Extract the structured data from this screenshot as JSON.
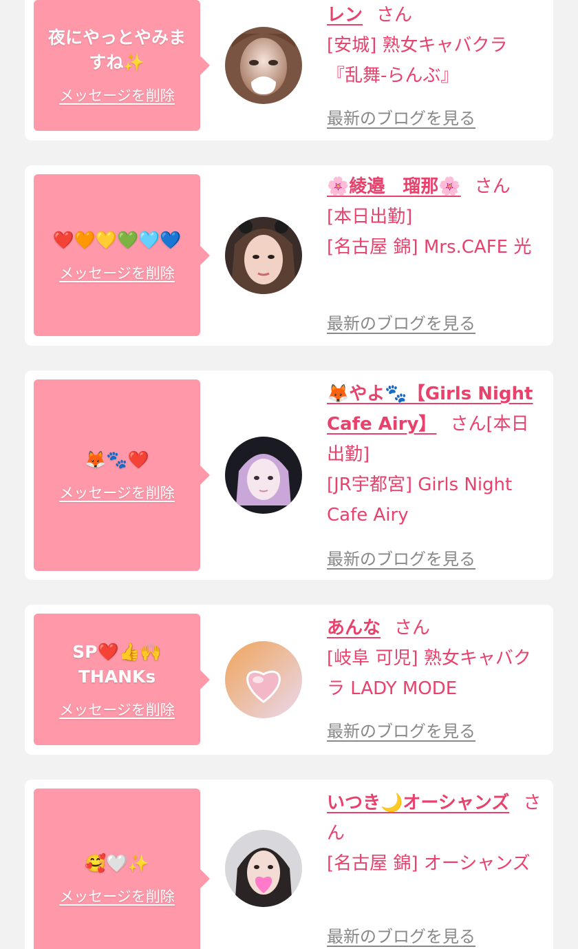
{
  "colors": {
    "background": "#f2f2f2",
    "card": "#ffffff",
    "bubble": "#ff99aa",
    "accent": "#e8416c",
    "blog_link": "#888888"
  },
  "cards": [
    {
      "message": "夜にやっとやみますね✨",
      "delete_label": "メッセージを削除",
      "name": "レン",
      "honorific": "さん",
      "details": [
        "[安城] 熟女キャバクラ『乱舞-らんぶ』"
      ],
      "blog_label": "最新のブログを見る"
    },
    {
      "message": "❤️🧡💛💚🩵💙",
      "delete_label": "メッセージを削除",
      "name": "🌸綾邉　瑠那🌸",
      "honorific": "さん",
      "details": [
        "[本日出勤]",
        "[名古屋 錦] Mrs.CAFE 光"
      ],
      "blog_label": "最新のブログを見る"
    },
    {
      "message": "🦊🐾❤️",
      "delete_label": "メッセージを削除",
      "name": "🦊やよ🐾【Girls Night Cafe Airy】",
      "honorific": "さん",
      "details": [
        "[本日出勤]",
        "[JR宇都宮] Girls Night Cafe Airy"
      ],
      "blog_label": "最新のブログを見る"
    },
    {
      "message": "SP❤️👍🙌THANKs",
      "delete_label": "メッセージを削除",
      "name": "あんな",
      "honorific": "さん",
      "details": [
        "[岐阜 可児] 熟女キャバクラ LADY MODE"
      ],
      "blog_label": "最新のブログを見る"
    },
    {
      "message": "🥰🤍✨",
      "delete_label": "メッセージを削除",
      "name": "いつき🌙オーシャンズ",
      "honorific": "さん",
      "details": [
        "[名古屋 錦] オーシャンズ"
      ],
      "blog_label": "最新のブログを見る"
    }
  ]
}
